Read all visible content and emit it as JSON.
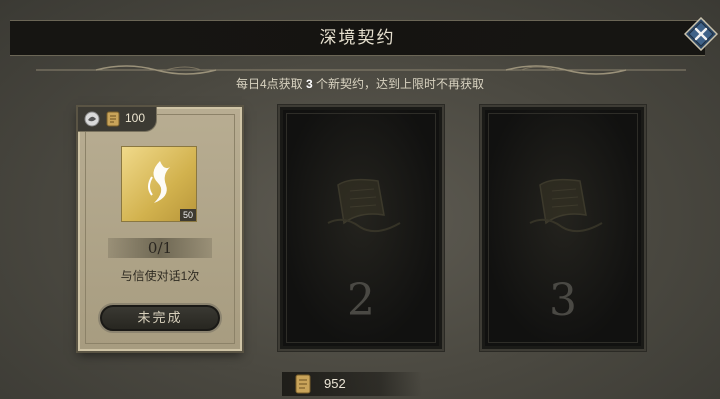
{
  "header": {
    "title": "深境契约"
  },
  "notice": {
    "prefix": "每日4点获取",
    "count": "3",
    "suffix": "个新契约，达到上限时不再获取"
  },
  "cards": [
    {
      "state": "active",
      "reward_amount": "100",
      "icon_badge": "50",
      "progress": "0/1",
      "description": "与信使对话1次",
      "status_label": "未完成"
    },
    {
      "state": "locked",
      "slot_number": "2"
    },
    {
      "state": "locked",
      "slot_number": "3"
    }
  ],
  "currency": {
    "amount": "952"
  },
  "colors": {
    "accent_gold": "#d2b24e",
    "panel_dark": "#151411",
    "card_parchment": "#b8ad92"
  }
}
